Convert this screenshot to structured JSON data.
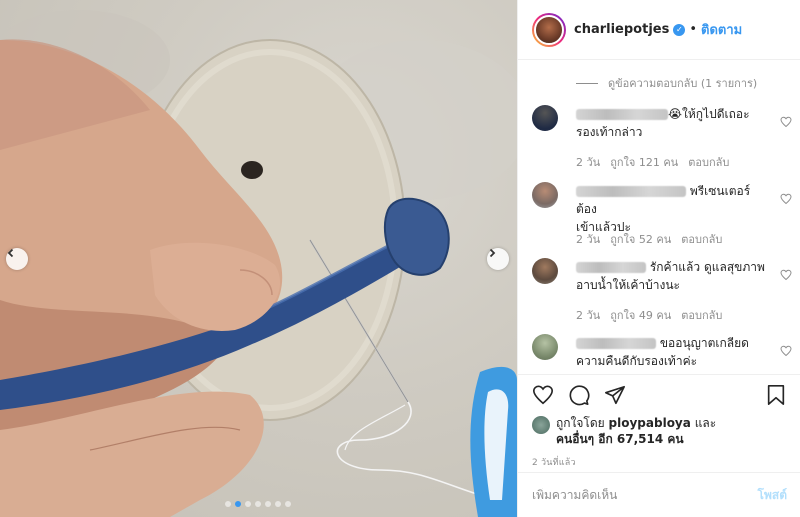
{
  "post": {
    "image_alt": "",
    "carousel": {
      "total": 7,
      "active_index": 1
    }
  },
  "header": {
    "username": "charliepotjes",
    "separator": "•",
    "follow_label": "ติดตาม",
    "verified_icon": "verified-badge-icon"
  },
  "comments": {
    "view_replies_label": "ดูข้อความตอบกลับ (1 รายการ)",
    "items": [
      {
        "text_line1": "😭ให้กูไปดีเถอะ",
        "text_line2": "รองเท้ากล่าว",
        "time": "2 วัน",
        "likes": "ถูกใจ 121 คน",
        "reply": "ตอบกลับ"
      },
      {
        "text_line1": "พรีเซนเตอร์ต้อง",
        "text_line2": "เข้าแล้วปะ",
        "time": "2 วัน",
        "likes": "ถูกใจ 52 คน",
        "reply": "ตอบกลับ"
      },
      {
        "text_line1": "รักค้าแล้ว ดูแลสุขภาพ",
        "text_line2": "อาบน้ำให้เค้าบ้างนะ",
        "time": "2 วัน",
        "likes": "ถูกใจ 49 คน",
        "reply": "ตอบกลับ"
      },
      {
        "text_line1": "ขออนุญาตเกลียด",
        "text_line2": "ความคืนดีกับรองเท้าค่ะ",
        "time": "",
        "likes": "",
        "reply": ""
      }
    ]
  },
  "actions": {
    "like_icon": "heart-icon",
    "comment_icon": "comment-bubble-icon",
    "share_icon": "paper-plane-icon",
    "save_icon": "bookmark-icon"
  },
  "likes": {
    "prefix": "ถูกใจโดย",
    "user": "ploypabloya",
    "and": "และ",
    "others": "คนอื่นๆ อีก 67,514 คน"
  },
  "timestamp": "2 วันที่แล้ว",
  "add_comment": {
    "placeholder": "เพิ่มความคิดเห็น",
    "post_label": "โพสต์"
  },
  "colors": {
    "accent": "#3897f0",
    "post_disabled": "#b2dffc",
    "muted": "#8e8e8e",
    "text": "#262626"
  }
}
